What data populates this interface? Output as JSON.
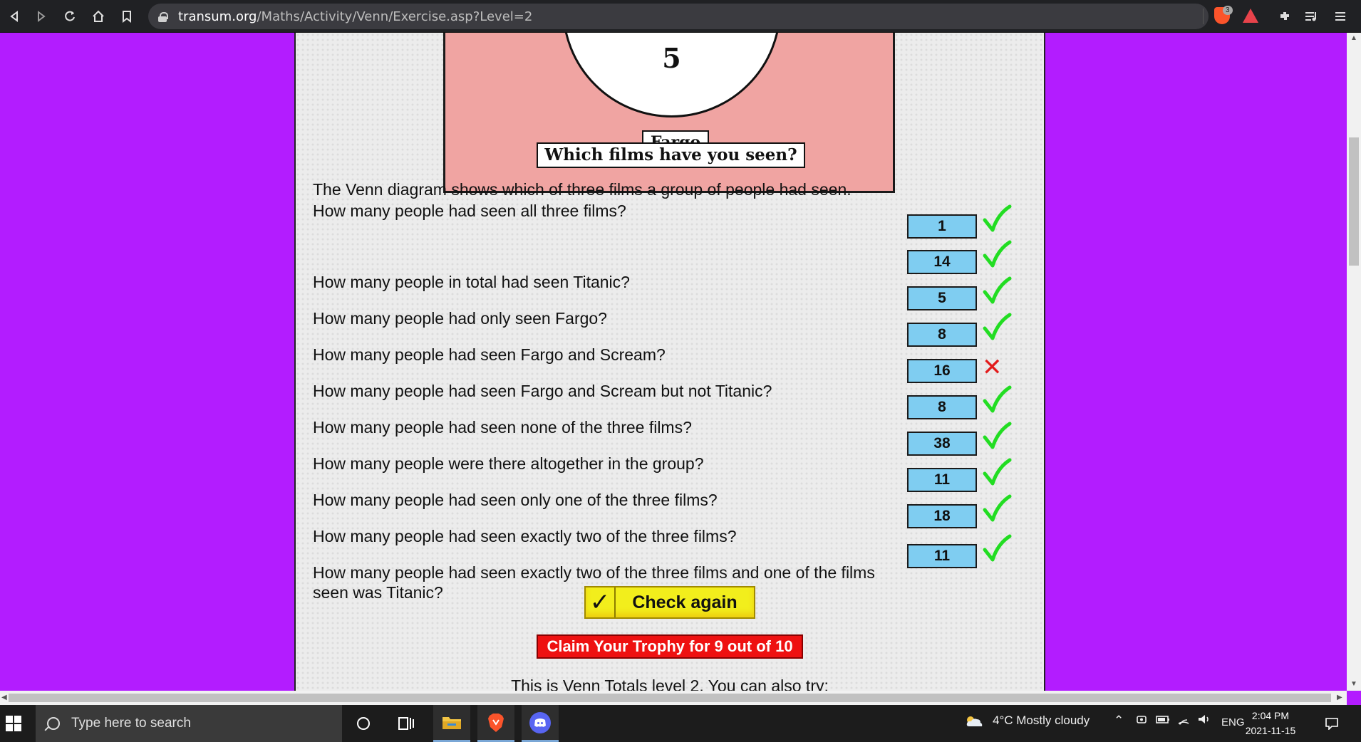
{
  "browser": {
    "url_host": "transum.org",
    "url_path": "/Maths/Activity/Venn/Exercise.asp?Level=2",
    "shield_count": "3"
  },
  "venn": {
    "center_value": "5",
    "set_label": "Fargo",
    "caption": "Which films have you seen?"
  },
  "intro": "The Venn diagram shows which of three films a group of people had seen.",
  "questions": [
    {
      "text": "How many people had seen all three films?",
      "answer": "1",
      "mark": "correct"
    },
    {
      "text": "How many people in total had seen Titanic?",
      "answer": "14",
      "mark": "correct"
    },
    {
      "text": "How many people had only seen Fargo?",
      "answer": "5",
      "mark": "correct"
    },
    {
      "text": "How many people had seen Fargo and Scream?",
      "answer": "8",
      "mark": "correct"
    },
    {
      "text": "How many people had seen Fargo and Scream but not Titanic?",
      "answer": "16",
      "mark": "wrong"
    },
    {
      "text": "How many people had seen none of the three films?",
      "answer": "8",
      "mark": "correct"
    },
    {
      "text": "How many people were there altogether in the group?",
      "answer": "38",
      "mark": "correct"
    },
    {
      "text": "How many people had seen only one of the three films?",
      "answer": "11",
      "mark": "correct"
    },
    {
      "text": "How many people had seen exactly two of the three films?",
      "answer": "18",
      "mark": "correct"
    },
    {
      "text": "How many people had seen exactly two of the three films and one of the films seen was Titanic?",
      "answer": "11",
      "mark": "correct"
    }
  ],
  "check_button": {
    "icon": "✓",
    "label": "Check again"
  },
  "trophy_button": "Claim Your Trophy for 9 out of 10",
  "level_text": "This is Venn Totals level 2. You can also try:",
  "taskbar": {
    "search_placeholder": "Type here to search",
    "weather": "4°C  Mostly cloudy",
    "language": "ENG",
    "time": "2:04 PM",
    "date": "2021-11-15"
  },
  "colors": {
    "page_bg": "#b31cff",
    "venn_bg": "#f0a4a2",
    "answer_bg": "#7fcdf1",
    "correct": "#22dd22",
    "wrong": "#e31b1b",
    "check_btn": "#f2ee1c",
    "trophy_btn": "#ee1111"
  }
}
